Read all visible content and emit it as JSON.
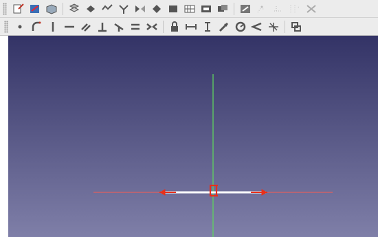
{
  "toolbar_top": {
    "icons": [
      "new-sketch-icon",
      "edit-sketch-icon",
      "view-sketch-icon",
      "map-sketch-icon",
      "reorient-sketch-icon",
      "validate-sketch-icon",
      "merge-sketch-icon",
      "mirror-sketch-icon",
      "leave-sketch-icon",
      "view-section-icon",
      "grid-icon",
      "snap-icon",
      "rendering-order-icon",
      "select-constraints-icon",
      "select-origin-icon",
      "select-conflicting-icon",
      "select-redundant-icon",
      "show-hide-icon"
    ]
  },
  "toolbar_sketch": {
    "icons": [
      "point-icon",
      "arc-icon",
      "vertical-line-icon",
      "horizontal-line-icon",
      "parallel-icon",
      "perpendicular-icon",
      "tangent-icon",
      "equal-icon",
      "symmetric-icon",
      "lock-icon",
      "horizontal-distance-icon",
      "vertical-distance-icon",
      "radius-icon",
      "diameter-icon",
      "angle-icon",
      "snell-law-icon",
      "toggle-driving-icon"
    ]
  },
  "viewport": {
    "colors": {
      "bg_top": "#333366",
      "bg_bottom": "#7f7fa8",
      "h_axis": "#e06060",
      "v_axis": "#5fd35f",
      "line": "#ffffff",
      "constraint": "#e8301a"
    }
  }
}
